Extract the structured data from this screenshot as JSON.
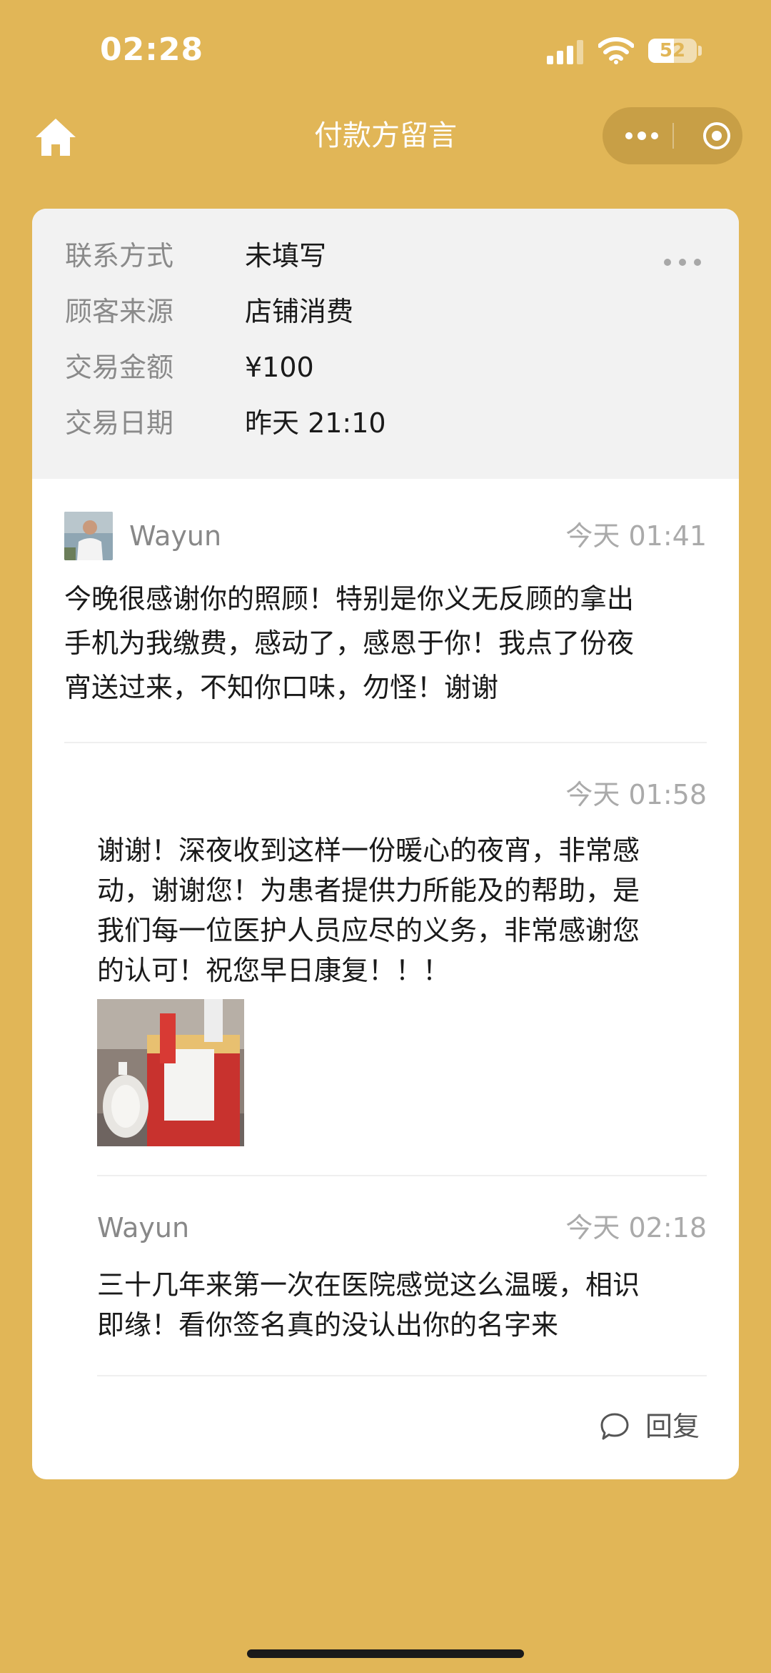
{
  "status_bar": {
    "time": "02:28",
    "battery_level": "52",
    "icons": [
      "signal-icon",
      "wifi-icon",
      "battery-icon"
    ]
  },
  "nav": {
    "title": "付款方留言",
    "icons": [
      "home-icon",
      "more-icon",
      "target-icon"
    ]
  },
  "info": {
    "rows": [
      {
        "label": "联系方式",
        "value": "未填写"
      },
      {
        "label": "顾客来源",
        "value": "店铺消费"
      },
      {
        "label": "交易金额",
        "value": "¥100"
      },
      {
        "label": "交易日期",
        "value": "昨天 21:10"
      }
    ]
  },
  "messages": [
    {
      "author": "Wayun",
      "time": "今天 01:41",
      "lines": [
        "今晚很感谢你的照顾！特别是你义无反顾的拿出",
        "手机为我缴费，感动了，感恩于你！我点了份夜",
        "宵送过来，不知你口味，勿怪！谢谢"
      ]
    },
    {
      "time": "今天 01:58",
      "lines": [
        "谢谢！深夜收到这样一份暖心的夜宵，非常感",
        "动，谢谢您！为患者提供力所能及的帮助，是",
        "我们每一位医护人员应尽的义务，非常感谢您",
        "的认可！祝您早日康复！！！"
      ]
    },
    {
      "author": "Wayun",
      "time": "今天 02:18",
      "lines": [
        "三十几年来第一次在医院感觉这么温暖，相识",
        "即缘！看你签名真的没认出你的名字来"
      ]
    }
  ],
  "reply": {
    "label": "回复",
    "icon": "chat-icon"
  },
  "colors": {
    "background": "#E1B657",
    "card": "#FFFFFF",
    "info_panel": "#F2F2F2"
  }
}
